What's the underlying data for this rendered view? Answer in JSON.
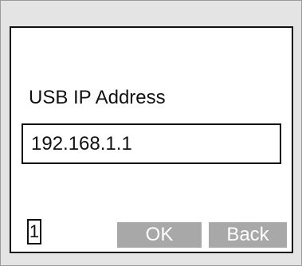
{
  "screen": {
    "field_label": "USB IP Address",
    "ip_value": "192.168.1.1",
    "page_indicator": "1"
  },
  "buttons": {
    "ok_label": "OK",
    "back_label": "Back"
  },
  "colors": {
    "bezel": "#e4e4e4",
    "screen_background": "#ffffff",
    "button_fill": "#a8a8a8",
    "button_text": "#ffffff",
    "text": "#111111"
  }
}
